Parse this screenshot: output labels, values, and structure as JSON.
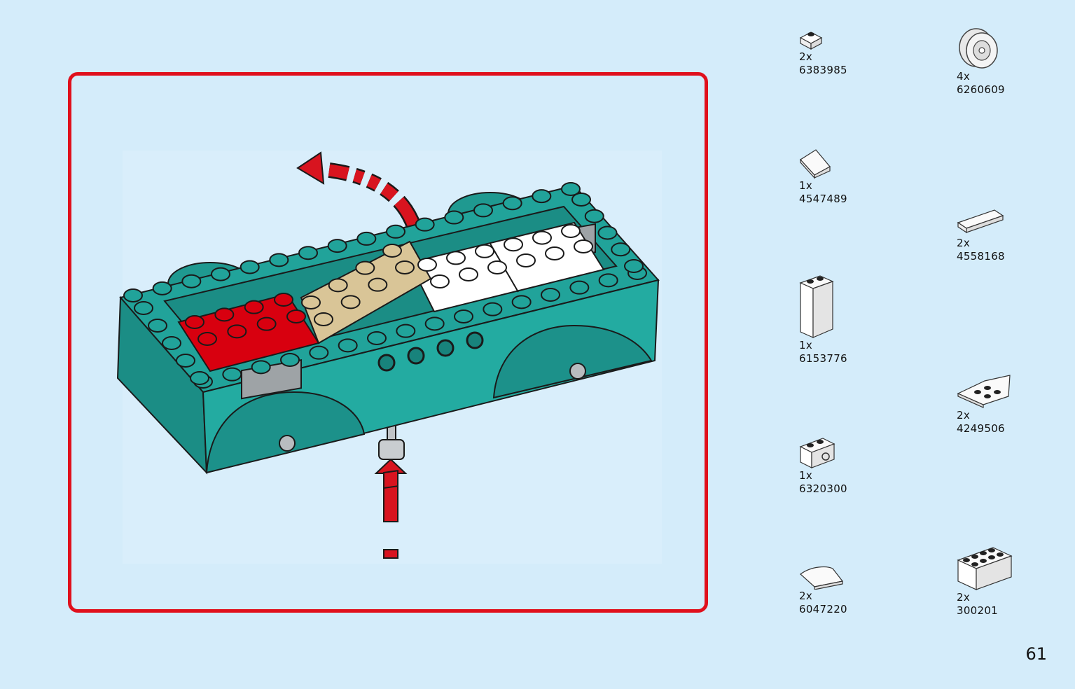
{
  "page": {
    "number": "61"
  },
  "parts": [
    {
      "qty": "2x",
      "id": "6383985",
      "icon": "round-plate-1x1-icon"
    },
    {
      "qty": "4x",
      "id": "6260609",
      "icon": "wheel-rim-icon"
    },
    {
      "qty": "1x",
      "id": "4547489",
      "icon": "slope-tile-icon"
    },
    {
      "qty": "2x",
      "id": "4558168",
      "icon": "tile-1x4-icon"
    },
    {
      "qty": "1x",
      "id": "6153776",
      "icon": "brick-1x2x3-icon"
    },
    {
      "qty": "2x",
      "id": "4249506",
      "icon": "wedge-plate-icon"
    },
    {
      "qty": "1x",
      "id": "6320300",
      "icon": "brick-clip-icon"
    },
    {
      "qty": "2x",
      "id": "6047220",
      "icon": "curved-slope-icon"
    },
    {
      "qty": "2x",
      "id": "300201",
      "icon": "brick-2x4-icon"
    }
  ],
  "colors": {
    "background": "#d4ecfa",
    "frame": "#e0101c",
    "chassis": "#21a39a",
    "red_brick": "#d8000f",
    "tan_plate": "#d9c597",
    "white_brick": "#ffffff"
  }
}
